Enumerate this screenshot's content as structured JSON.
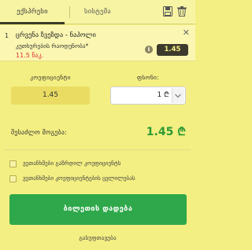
{
  "tabs": {
    "express": "ექსპრესი",
    "system": "სისტემა"
  },
  "bet": {
    "number": "1",
    "title": "ცრვენა ზვეზდა - ნაპოლი",
    "market": "კუთხურების რაოდენობა*",
    "date": "11.5 ნაკ.",
    "odds": "1.45"
  },
  "form": {
    "coef_label": "კოეფიციენტი",
    "price_label": "ფსონი:",
    "coef_value": "1.45",
    "stake_value": "1 ₾"
  },
  "win": {
    "label": "შესაძლო მოგება:",
    "value": "1.45 ₾"
  },
  "options": [
    "ვეთანხმები გაზრდილ კოეფიციენტს",
    "ვეთანხმები კოეფიციენტების ცვლილებას"
  ],
  "actions": {
    "place": "ბილეთის დადება",
    "clear": "გასუფთავება"
  },
  "colors": {
    "background": "#f4ef82",
    "accent_green": "#2ea84a",
    "odds_badge": "#3d3a2d",
    "date_red": "#dd3333"
  }
}
